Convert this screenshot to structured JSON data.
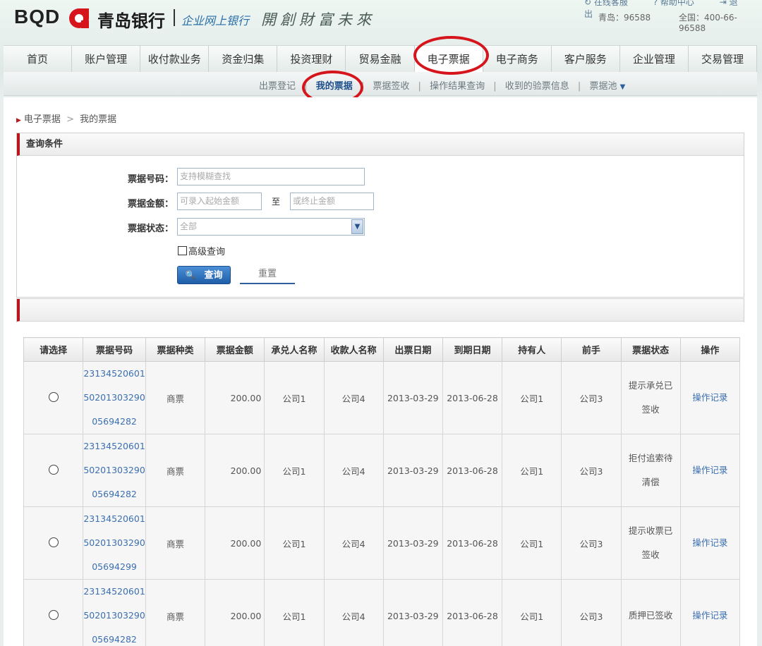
{
  "header": {
    "logo_text": "BQD",
    "bank_name": "青岛银行",
    "ebank_label": "企业网上银行",
    "slogan": "開創財富未來",
    "top_links": [
      "在线客服",
      "帮助中心",
      "退出"
    ],
    "hotline_qingdao": "青岛：96588",
    "hotline_national": "全国：400-66-96588"
  },
  "nav": [
    "首页",
    "账户管理",
    "收付款业务",
    "资金归集",
    "投资理财",
    "贸易金融",
    "电子票据",
    "电子商务",
    "客户服务",
    "企业管理",
    "交易管理"
  ],
  "subnav": [
    "出票登记",
    "我的票据",
    "票据签收",
    "操作结果查询",
    "收到的验票信息",
    "票据池"
  ],
  "breadcrumb": [
    "电子票据",
    "我的票据"
  ],
  "query": {
    "title": "查询条件",
    "bill_no_label": "票据号码：",
    "bill_no_placeholder": "支持模糊查找",
    "amount_label": "票据金额：",
    "amount_from_placeholder": "可录入起始金额",
    "to_label": "至",
    "amount_to_placeholder": "或终止金额",
    "status_label": "票据状态：",
    "status_value": "全部",
    "advanced_label": "高级查询",
    "query_button": "查询",
    "reset_button": "重置"
  },
  "table": {
    "headers": [
      "请选择",
      "票据号码",
      "票据种类",
      "票据金额",
      "承兑人名称",
      "收款人名称",
      "出票日期",
      "到期日期",
      "持有人",
      "前手",
      "票据状态",
      "操作"
    ],
    "rows": [
      {
        "bill_no": [
          "23134520601",
          "50201303290",
          "05694282"
        ],
        "type": "商票",
        "amount": "200.00",
        "acceptor": "公司1",
        "payee": "公司4",
        "issue_date": "2013-03-29",
        "due_date": "2013-06-28",
        "holder": "公司1",
        "prior": "公司3",
        "status": [
          "提示承兑已",
          "签收"
        ],
        "action": "操作记录"
      },
      {
        "bill_no": [
          "23134520601",
          "50201303290",
          "05694282"
        ],
        "type": "商票",
        "amount": "200.00",
        "acceptor": "公司1",
        "payee": "公司4",
        "issue_date": "2013-03-29",
        "due_date": "2013-06-28",
        "holder": "公司1",
        "prior": "公司3",
        "status": [
          "拒付追索待",
          "清偿"
        ],
        "action": "操作记录"
      },
      {
        "bill_no": [
          "23134520601",
          "50201303290",
          "05694299"
        ],
        "type": "商票",
        "amount": "200.00",
        "acceptor": "公司1",
        "payee": "公司4",
        "issue_date": "2013-03-29",
        "due_date": "2013-06-28",
        "holder": "公司1",
        "prior": "公司3",
        "status": [
          "提示收票已",
          "签收"
        ],
        "action": "操作记录"
      },
      {
        "bill_no": [
          "23134520601",
          "50201303290",
          "05694282"
        ],
        "type": "商票",
        "amount": "200.00",
        "acceptor": "公司1",
        "payee": "公司4",
        "issue_date": "2013-03-29",
        "due_date": "2013-06-28",
        "holder": "公司1",
        "prior": "公司3",
        "status": [
          "质押已签收"
        ],
        "action": "操作记录"
      }
    ]
  },
  "colors": {
    "brand_red": "#d5141b",
    "link_blue": "#3b6fb3",
    "button_blue": "#1e5ea8"
  }
}
